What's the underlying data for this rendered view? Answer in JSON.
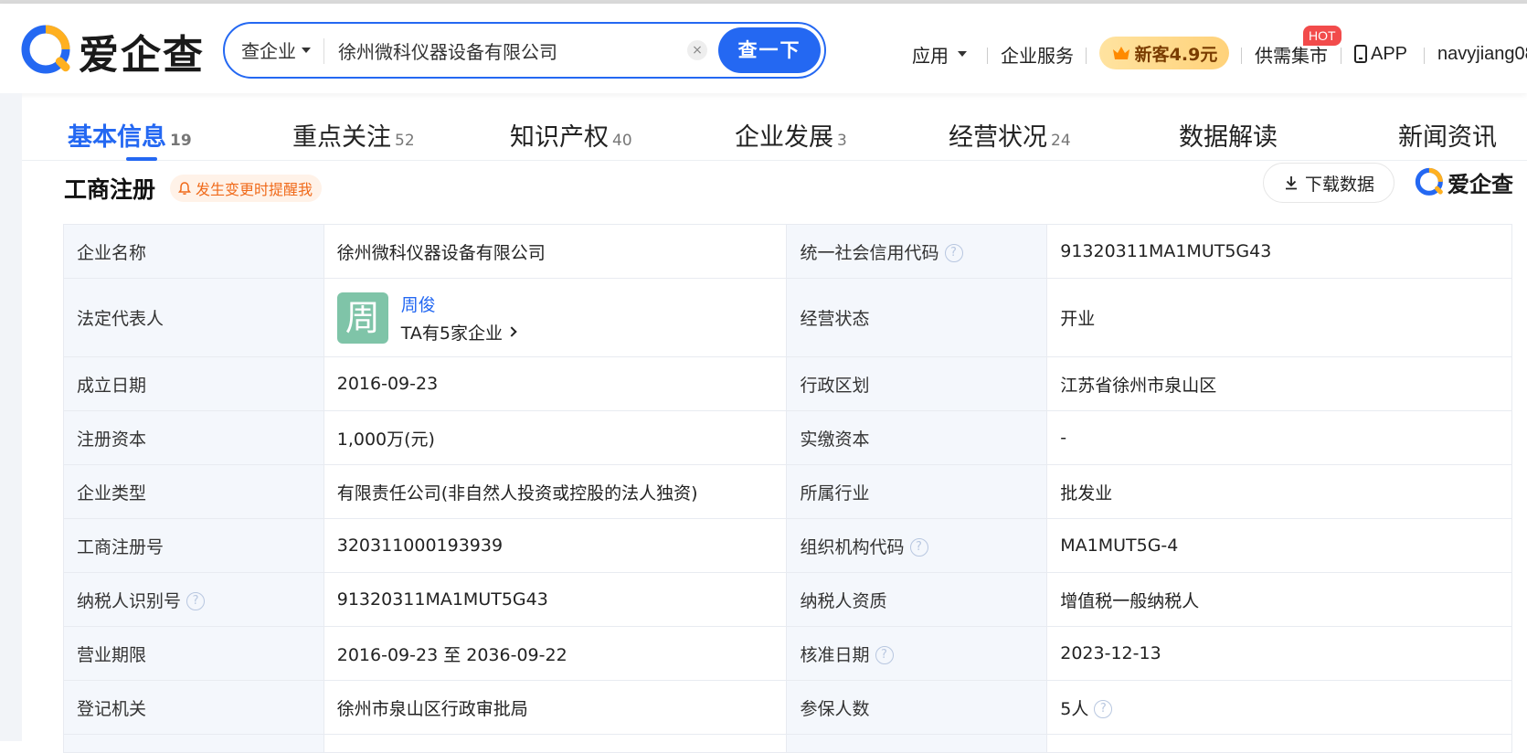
{
  "brand": {
    "name": "爱企查",
    "accent": "#2468f2"
  },
  "search": {
    "type_label": "查企业",
    "value": "徐州微科仪器设备有限公司",
    "clear": "×",
    "button": "查一下"
  },
  "nav": {
    "apps": "应用",
    "service": "企业服务",
    "promo": "新客4.9元",
    "market": "供需集市",
    "hot": "HOT",
    "app": "APP",
    "user": "navyjiang08"
  },
  "tabs": [
    {
      "label": "基本信息",
      "count": "19"
    },
    {
      "label": "重点关注",
      "count": "52"
    },
    {
      "label": "知识产权",
      "count": "40"
    },
    {
      "label": "企业发展",
      "count": "3"
    },
    {
      "label": "经营状况",
      "count": "24"
    },
    {
      "label": "数据解读",
      "count": ""
    },
    {
      "label": "新闻资讯",
      "count": ""
    }
  ],
  "section": {
    "title": "工商注册",
    "remind": "发生变更时提醒我",
    "download": "下载数据"
  },
  "rows": [
    {
      "l1": "企业名称",
      "v1": "徐州微科仪器设备有限公司",
      "l2": "统一社会信用代码",
      "v2": "91320311MA1MUT5G43"
    },
    {
      "l1": "法定代表人",
      "rep_avatar": "周",
      "rep_name": "周俊",
      "rep_link": "TA有5家企业",
      "l2": "经营状态",
      "v2": "开业"
    },
    {
      "l1": "成立日期",
      "v1": "2016-09-23",
      "l2": "行政区划",
      "v2": "江苏省徐州市泉山区"
    },
    {
      "l1": "注册资本",
      "v1": "1,000万(元)",
      "l2": "实缴资本",
      "v2": "-"
    },
    {
      "l1": "企业类型",
      "v1": "有限责任公司(非自然人投资或控股的法人独资)",
      "l2": "所属行业",
      "v2": "批发业"
    },
    {
      "l1": "工商注册号",
      "v1": "320311000193939",
      "l2": "组织机构代码",
      "v2": "MA1MUT5G-4"
    },
    {
      "l1": "纳税人识别号",
      "v1": "91320311MA1MUT5G43",
      "l2": "纳税人资质",
      "v2": "增值税一般纳税人"
    },
    {
      "l1": "营业期限",
      "v1": "2016-09-23 至 2036-09-22",
      "l2": "核准日期",
      "v2": "2023-12-13"
    },
    {
      "l1": "登记机关",
      "v1": "徐州市泉山区行政审批局",
      "l2": "参保人数",
      "v2": "5人"
    }
  ],
  "help_mark": "?"
}
